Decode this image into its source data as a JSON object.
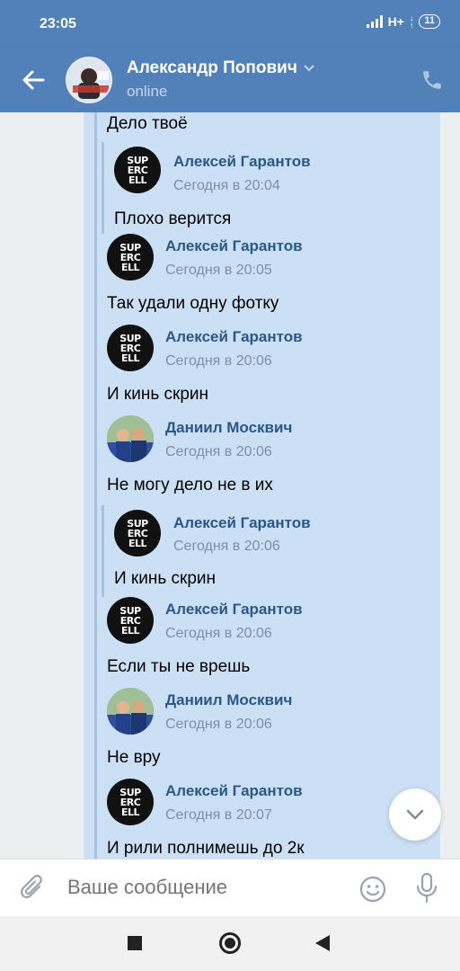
{
  "status_bar": {
    "time": "23:05",
    "network": "H+",
    "battery": "11"
  },
  "header": {
    "name": "Александр Попович",
    "status": "online"
  },
  "messages": [
    {
      "kind": "text",
      "text": "Дело твоё"
    },
    {
      "kind": "fwd",
      "author": "Алексей Гарантов",
      "date": "Сегодня в 20:04",
      "avatar": "supercell-logo",
      "text": "Плохо верится"
    },
    {
      "kind": "fwd",
      "author": "Алексей Гарантов",
      "date": "Сегодня в 20:05",
      "avatar": "supercell-logo",
      "text": "Так удали одну фотку"
    },
    {
      "kind": "fwd",
      "author": "Алексей Гарантов",
      "date": "Сегодня в 20:06",
      "avatar": "supercell-logo",
      "text": "И кинь скрин"
    },
    {
      "kind": "fwd",
      "author": "Даниил Москвич",
      "date": "Сегодня в 20:06",
      "avatar": "photo",
      "text": "Не могу дело не в их"
    },
    {
      "kind": "fwd",
      "author": "Алексей Гарантов",
      "date": "Сегодня в 20:06",
      "avatar": "supercell-logo",
      "text": "И кинь скрин"
    },
    {
      "kind": "fwd",
      "author": "Алексей Гарантов",
      "date": "Сегодня в 20:06",
      "avatar": "supercell-logo",
      "text": "Если ты не врешь"
    },
    {
      "kind": "fwd",
      "author": "Даниил Москвич",
      "date": "Сегодня в 20:06",
      "avatar": "photo",
      "text": "Не вру"
    },
    {
      "kind": "fwd",
      "author": "Алексей Гарантов",
      "date": "Сегодня в 20:07",
      "avatar": "supercell-logo",
      "text": "И рили полнимешь до 2к"
    }
  ],
  "logo_text": [
    "SUP",
    "ERC",
    "ELL"
  ],
  "composer": {
    "placeholder": "Ваше сообщение"
  },
  "icons": {
    "back": "arrow-left-icon",
    "call": "phone-icon",
    "attach": "paperclip-icon",
    "emoji": "smile-icon",
    "mic": "microphone-icon",
    "scroll": "chevron-down-icon"
  },
  "colors": {
    "header": "#5181b8",
    "bubble": "#cce0f5",
    "author": "#2a5885"
  }
}
